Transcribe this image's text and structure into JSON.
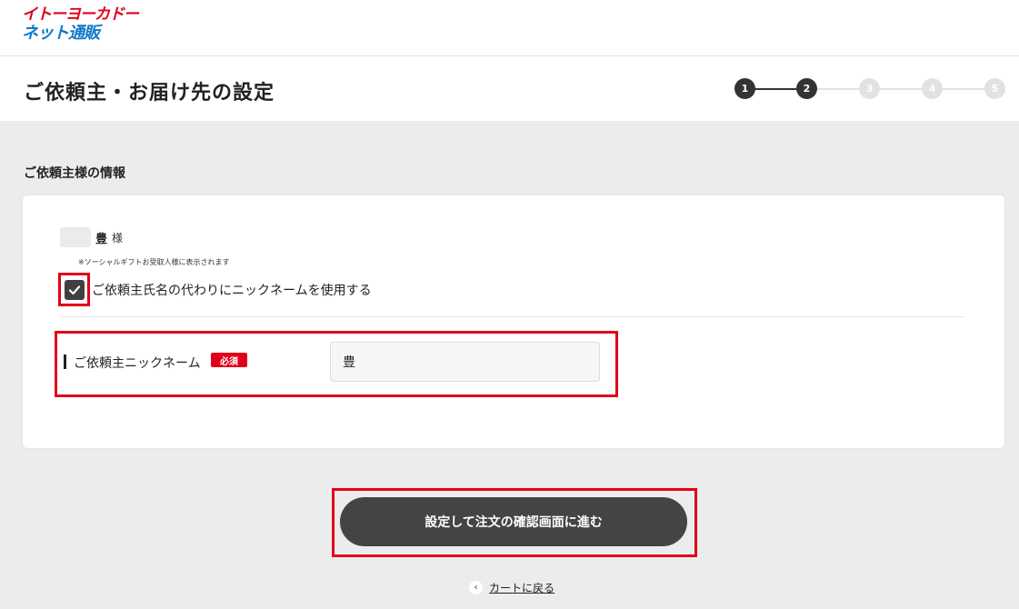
{
  "brand": {
    "line1": "イトーヨーカドー",
    "line2": "ネット通販"
  },
  "page": {
    "title": "ご依頼主・お届け先の設定"
  },
  "stepper": {
    "steps": [
      "1",
      "2",
      "3",
      "4",
      "5"
    ],
    "current_step": 2,
    "active_color": "#333333",
    "inactive_color": "#e2e2e2"
  },
  "section": {
    "title": "ご依頼主様の情報"
  },
  "sender": {
    "name": "豊",
    "honorific": "様",
    "note": "※ソーシャルギフトお受取人様に表示されます"
  },
  "nickname_option": {
    "label": "ご依頼主氏名の代わりにニックネームを使用する",
    "checked": true
  },
  "nickname_field": {
    "label": "ご依頼主ニックネーム",
    "required_badge": "必須",
    "value": "豊"
  },
  "actions": {
    "submit_label": "設定して注文の確認画面に進む",
    "back_label": "カートに戻る"
  },
  "colors": {
    "accent_red": "#e0001a",
    "brand_blue": "#1178c8",
    "button_dark": "#444444"
  }
}
